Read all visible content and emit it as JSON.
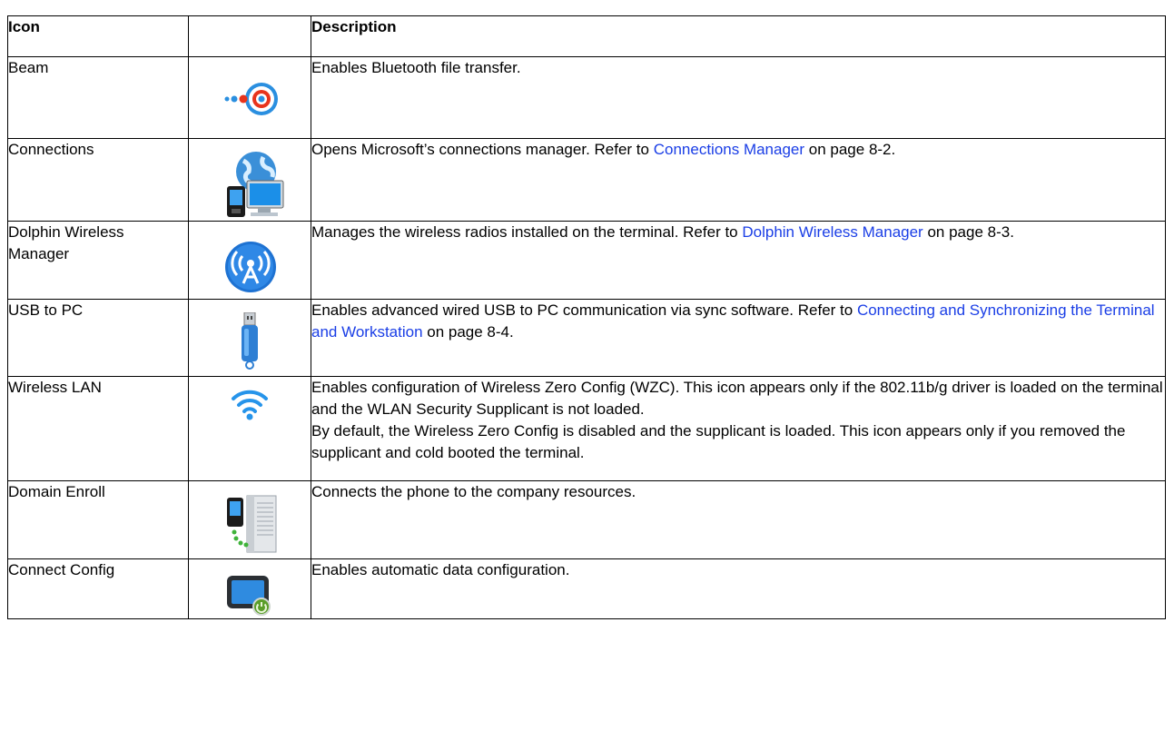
{
  "table": {
    "headers": {
      "icon": "Icon",
      "icon_image": "",
      "description": "Description"
    },
    "rows": [
      {
        "name": "Beam",
        "icon": "beam-bluetooth-icon",
        "desc": {
          "text": "Enables Bluetooth file transfer."
        }
      },
      {
        "name": "Connections",
        "icon": "connections-globe-computer-icon",
        "desc": {
          "before": "Opens Microsoft’s connections manager. Refer to ",
          "link": "Connections Manager",
          "after": " on page 8-2."
        }
      },
      {
        "name": "Dolphin Wireless Manager",
        "icon": "wireless-manager-antenna-icon",
        "desc": {
          "before": "Manages the wireless radios installed on the terminal. Refer to ",
          "link": "Dolphin Wireless Manager",
          "after": " on page 8-3."
        }
      },
      {
        "name": "USB to PC",
        "icon": "usb-drive-icon",
        "desc": {
          "before": "Enables advanced wired USB to PC communication via sync software. Refer to ",
          "link": "Connecting and Synchronizing the Terminal and Workstation",
          "after": " on page 8-4."
        }
      },
      {
        "name": "Wireless LAN",
        "icon": "wifi-signal-icon",
        "desc": {
          "p1": "Enables configuration of Wireless Zero Config (WZC). This icon appears only if the 802.11b/g driver is loaded on the terminal and the WLAN Security Supplicant is not loaded.",
          "p2": "By default, the Wireless Zero Config is disabled and the supplicant is loaded. This icon appears only if you removed the supplicant and cold booted the terminal."
        }
      },
      {
        "name": "Domain Enroll",
        "icon": "domain-enroll-phone-server-icon",
        "desc": {
          "text": "Connects the phone to the company resources."
        }
      },
      {
        "name": "Connect Config",
        "icon": "connect-config-monitor-icon",
        "desc": {
          "text": "Enables automatic data configuration."
        }
      }
    ]
  },
  "colors": {
    "link": "#1a3ee6",
    "border": "#000000"
  }
}
